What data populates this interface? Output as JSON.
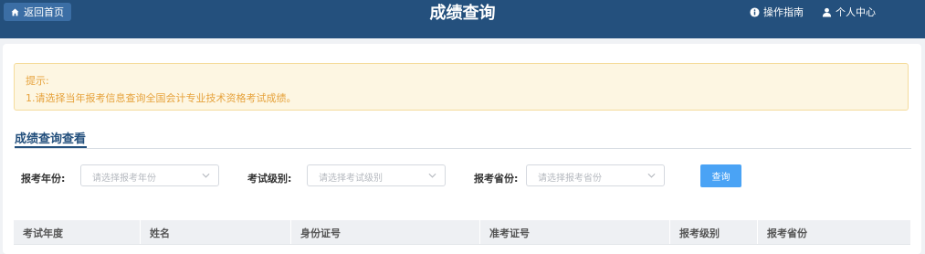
{
  "header": {
    "back_label": "返回首页",
    "title": "成绩查询",
    "guide_label": "操作指南",
    "user_center_label": "个人中心"
  },
  "notice": {
    "title": "提示:",
    "text": "1.请选择当年报考信息查询全国会计专业技术资格考试成绩。"
  },
  "tab": {
    "label": "成绩查询查看"
  },
  "filters": [
    {
      "label": "报考年份:",
      "placeholder": "请选择报考年份"
    },
    {
      "label": "考试级别:",
      "placeholder": "请选择考试级别"
    },
    {
      "label": "报考省份:",
      "placeholder": "请选择报考省份"
    }
  ],
  "query_button": "查询",
  "table": {
    "columns": [
      "考试年度",
      "姓名",
      "身份证号",
      "准考证号",
      "报考级别",
      "报考省份"
    ]
  },
  "colors": {
    "header_bg": "#24507d",
    "notice_bg": "#fdf6e2",
    "notice_text": "#e6a23c",
    "button_bg": "#4aa3f5"
  }
}
